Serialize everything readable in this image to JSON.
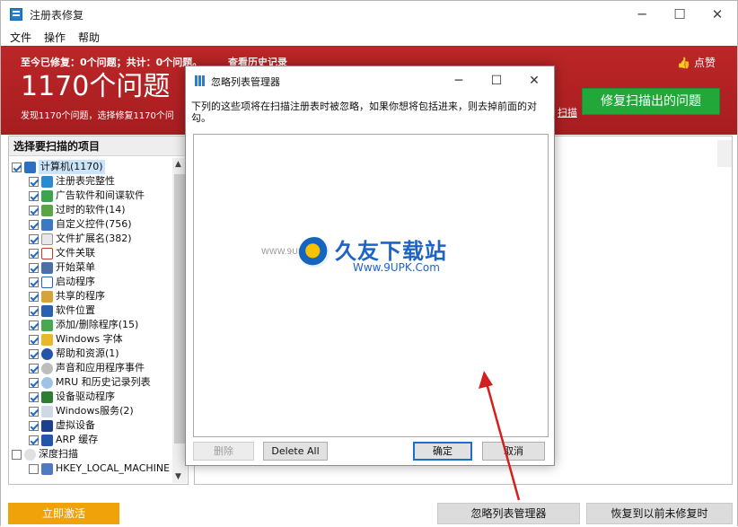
{
  "app": {
    "title": "注册表修复"
  },
  "window_controls": {
    "minimize": "─",
    "maximize": "☐",
    "close": "✕"
  },
  "menu": [
    "文件",
    "操作",
    "帮助"
  ],
  "header": {
    "stats": "至今已修复：0个问题；共计：0个问题。",
    "history_link": "查看历史记录",
    "like": "点赞",
    "count": "1170个问题",
    "description": "发现1170个问题，选择修复1170个问",
    "scan_link": "扫描",
    "fix_button": "修复扫描出的问题",
    "colors": {
      "header": "#b32224",
      "fix": "#21a838"
    }
  },
  "left_panel": {
    "title": "选择要扫描的项目",
    "items": [
      {
        "label": "计算机(1170)",
        "checked": true,
        "icon": "computer-icon"
      },
      {
        "label": "注册表完整性",
        "checked": true,
        "icon": "registry-icon"
      },
      {
        "label": "广告软件和间谍软件",
        "checked": true,
        "icon": "shield-icon"
      },
      {
        "label": "过时的软件(14)",
        "checked": true,
        "icon": "trash-icon"
      },
      {
        "label": "自定义控件(756)",
        "checked": true,
        "icon": "controls-icon"
      },
      {
        "label": "文件扩展名(382)",
        "checked": true,
        "icon": "file-icon"
      },
      {
        "label": "文件关联",
        "checked": true,
        "icon": "file-assoc-icon"
      },
      {
        "label": "开始菜单",
        "checked": true,
        "icon": "start-menu-icon"
      },
      {
        "label": "启动程序",
        "checked": true,
        "icon": "startup-icon"
      },
      {
        "label": "共享的程序",
        "checked": true,
        "icon": "share-icon"
      },
      {
        "label": "软件位置",
        "checked": true,
        "icon": "folder-icon"
      },
      {
        "label": "添加/删除程序(15)",
        "checked": true,
        "icon": "recycle-icon"
      },
      {
        "label": "Windows 字体",
        "checked": true,
        "icon": "font-icon"
      },
      {
        "label": "帮助和资源(1)",
        "checked": true,
        "icon": "help-icon"
      },
      {
        "label": "声音和应用程序事件",
        "checked": true,
        "icon": "sound-icon"
      },
      {
        "label": "MRU 和历史记录列表",
        "checked": true,
        "icon": "history-icon"
      },
      {
        "label": "设备驱动程序",
        "checked": true,
        "icon": "driver-icon"
      },
      {
        "label": "Windows服务(2)",
        "checked": true,
        "icon": "service-icon"
      },
      {
        "label": "虚拟设备",
        "checked": true,
        "icon": "virtual-device-icon"
      },
      {
        "label": "ARP 缓存",
        "checked": true,
        "icon": "arp-icon"
      },
      {
        "label": "深度扫描",
        "checked": false,
        "icon": "deep-scan-icon"
      },
      {
        "label": "HKEY_LOCAL_MACHINE",
        "checked": false,
        "icon": "hklm-icon"
      }
    ]
  },
  "bottom": {
    "activate": "立即激活",
    "ignore_list": "忽略列表管理器",
    "restore": "恢复到以前未修复时"
  },
  "dialog": {
    "title": "忽略列表管理器",
    "description": "下列的这些项将在扫描注册表时被忽略，如果你想将包括进来，则去掉前面的对勾。",
    "delete": "删除",
    "delete_all": "Delete All",
    "ok": "确定",
    "cancel": "取消"
  },
  "watermark": {
    "main": "久友下载站",
    "url": "WWW.9UPK.COM",
    "sub": "Www.9UPK.Com"
  }
}
